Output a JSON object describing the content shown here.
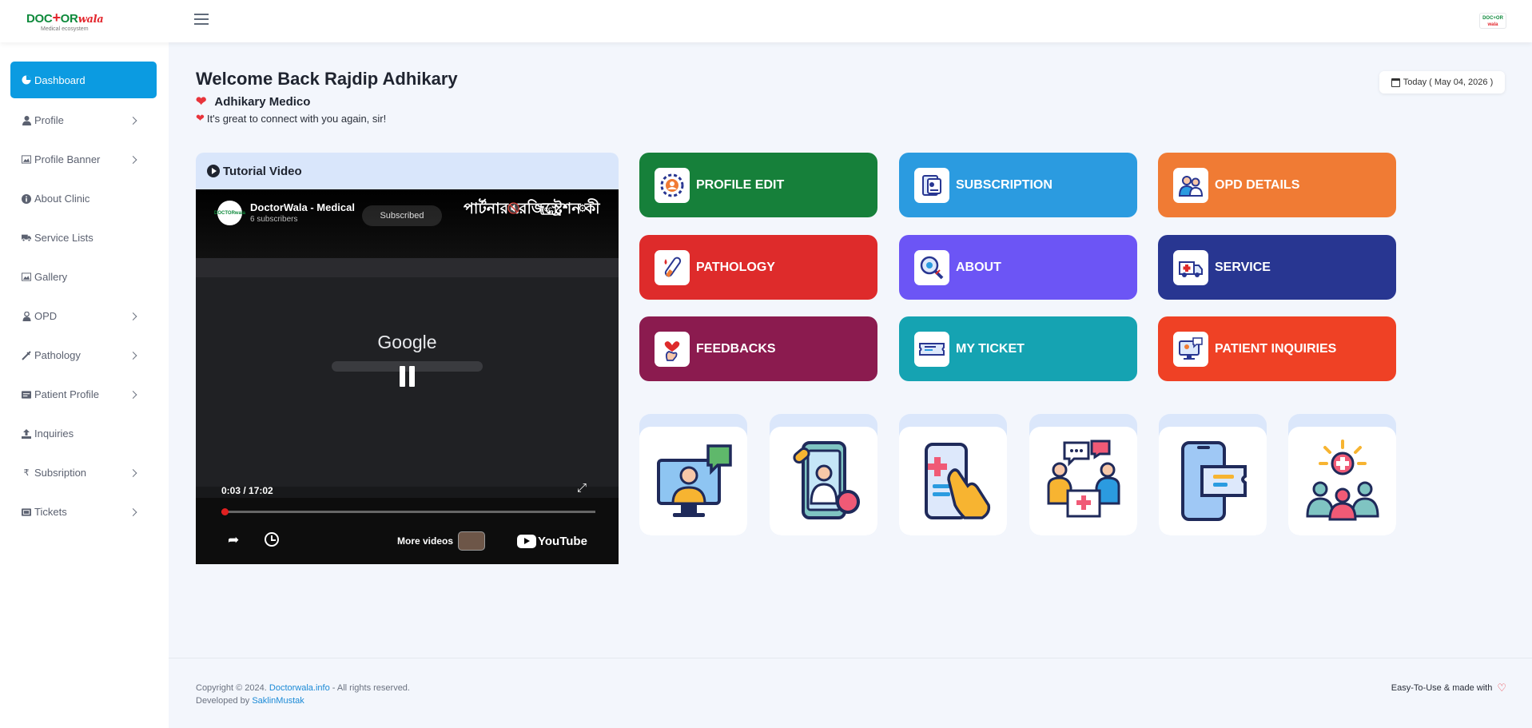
{
  "header": {
    "logo_brand_1": "DOC",
    "logo_plus": "+",
    "logo_brand_2": "OR",
    "logo_brand_3": "wala",
    "logo_tagline": "Medical ecosystem",
    "mini_logo_1": "DOC+OR",
    "mini_logo_2": "wala"
  },
  "sidebar": {
    "items": [
      {
        "label": "Dashboard",
        "icon": "pie-chart-icon",
        "active": true
      },
      {
        "label": "Profile",
        "icon": "user-icon"
      },
      {
        "label": "Profile Banner",
        "icon": "image-icon"
      },
      {
        "label": "About Clinic",
        "icon": "info-icon"
      },
      {
        "label": "Service Lists",
        "icon": "truck-icon"
      },
      {
        "label": "Gallery",
        "icon": "image-icon"
      },
      {
        "label": "OPD",
        "icon": "doctor-icon"
      },
      {
        "label": "Pathology",
        "icon": "syringe-icon"
      },
      {
        "label": "Patient Profile",
        "icon": "id-card-icon"
      },
      {
        "label": "Inquiries",
        "icon": "upload-icon"
      },
      {
        "label": "Subsription",
        "icon": "rupee-icon"
      },
      {
        "label": "Tickets",
        "icon": "ticket-icon"
      }
    ]
  },
  "main": {
    "welcome": "Welcome Back Rajdip Adhikary",
    "clinic_name": "Adhikary Medico",
    "greeting": "It's great to connect with you again, sir!",
    "today": "Today ( May 04, 2026 )"
  },
  "video": {
    "card_title": "Tutorial Video",
    "channel_avatar": "DOCTORwala",
    "channel_name": "DoctorWala - Medical",
    "channel_subs": "6 subscribers",
    "video_title": "পার্টনার রেজিস্ট্রেশন কী",
    "subscribe_label": "Subscribed",
    "screen_text": "Google",
    "time": "0:03 / 17:02",
    "progress_fraction": 0.003,
    "more_videos": "More videos",
    "youtube": "YouTube"
  },
  "tiles": [
    {
      "label": "PROFILE EDIT",
      "color": "#16803a",
      "icon": "profile-gear-icon"
    },
    {
      "label": "SUBSCRIPTION",
      "color": "#2b9be0",
      "icon": "subscription-icon"
    },
    {
      "label": "OPD DETAILS",
      "color": "#f07b34",
      "icon": "opd-icon"
    },
    {
      "label": "PATHOLOGY",
      "color": "#de2b2b",
      "icon": "test-tube-icon"
    },
    {
      "label": "ABOUT",
      "color": "#6c55f5",
      "icon": "magnifier-icon"
    },
    {
      "label": "SERVICE",
      "color": "#283691",
      "icon": "ambulance-icon"
    },
    {
      "label": "FEEDBACKS",
      "color": "#8b1b4f",
      "icon": "heart-hand-icon"
    },
    {
      "label": "MY TICKET",
      "color": "#15a3b2",
      "icon": "ticket-icon"
    },
    {
      "label": "PATIENT INQUIRIES",
      "color": "#ef4125",
      "icon": "inquiry-screen-icon"
    }
  ],
  "illustrations": [
    {
      "icon": "telemedicine-icon"
    },
    {
      "icon": "doctor-phone-icon"
    },
    {
      "icon": "mobile-health-icon"
    },
    {
      "icon": "consultation-icon"
    },
    {
      "icon": "mobile-ticket-icon"
    },
    {
      "icon": "patients-care-icon"
    }
  ],
  "footer": {
    "copyright_prefix": "Copyright © 2024.",
    "copyright_link": "Doctorwala.info",
    "copyright_suffix": "- All rights reserved.",
    "developed_prefix": "Developed by",
    "developed_link": "SaklinMustak",
    "made_with": "Easy-To-Use & made with"
  }
}
